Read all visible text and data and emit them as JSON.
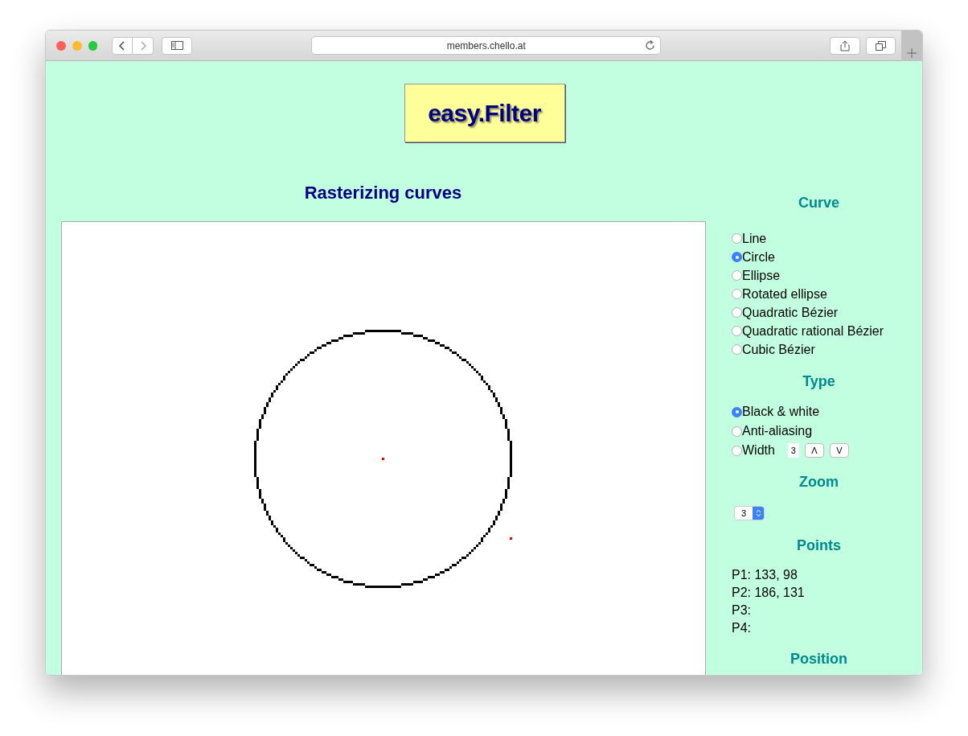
{
  "browser": {
    "url": "members.chello.at"
  },
  "logo": {
    "text": "easy.Filter"
  },
  "heading": "Rasterizing curves",
  "curve": {
    "title": "Curve",
    "options": [
      {
        "label": "Line",
        "selected": false
      },
      {
        "label": "Circle",
        "selected": true
      },
      {
        "label": "Ellipse",
        "selected": false
      },
      {
        "label": "Rotated ellipse",
        "selected": false
      },
      {
        "label": "Quadratic Bézier",
        "selected": false
      },
      {
        "label": "Quadratic rational Bézier",
        "selected": false
      },
      {
        "label": "Cubic Bézier",
        "selected": false
      }
    ]
  },
  "type": {
    "title": "Type",
    "options": [
      {
        "label": "Black & white",
        "selected": true,
        "kind": "plain"
      },
      {
        "label": "Anti-aliasing",
        "selected": false,
        "kind": "plain"
      },
      {
        "label": "Width",
        "selected": false,
        "kind": "width",
        "value": "3",
        "buttons": [
          "Λ",
          "V"
        ]
      }
    ]
  },
  "zoom": {
    "title": "Zoom",
    "value": "3"
  },
  "points": {
    "title": "Points",
    "items": [
      "P1: 133, 98",
      "P2: 186, 131",
      "P3:",
      "P4:"
    ]
  },
  "position": {
    "title": "Position"
  }
}
